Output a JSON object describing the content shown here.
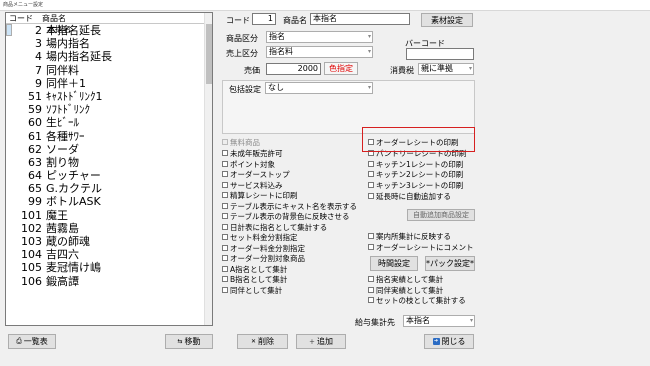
{
  "window": {
    "title": "商品メニュー設定"
  },
  "list": {
    "headers": {
      "code": "コード",
      "name": "商品名"
    },
    "items": [
      {
        "code": "1",
        "name": "本指名"
      },
      {
        "code": "2",
        "name": "本指名延長"
      },
      {
        "code": "3",
        "name": "場内指名"
      },
      {
        "code": "4",
        "name": "場内指名延長"
      },
      {
        "code": "7",
        "name": "同伴料"
      },
      {
        "code": "9",
        "name": "同伴＋1"
      },
      {
        "code": "51",
        "name": "ｷｬｽﾄﾄﾞﾘﾝｸ1"
      },
      {
        "code": "59",
        "name": "ｿﾌﾄﾄﾞﾘﾝｸ"
      },
      {
        "code": "60",
        "name": "生ﾋﾞｰﾙ"
      },
      {
        "code": "61",
        "name": "各種ｻﾜｰ"
      },
      {
        "code": "62",
        "name": "ソーダ"
      },
      {
        "code": "63",
        "name": "割り物"
      },
      {
        "code": "64",
        "name": "ピッチャー"
      },
      {
        "code": "65",
        "name": "G.カクテル"
      },
      {
        "code": "99",
        "name": "ボトルASK"
      },
      {
        "code": "101",
        "name": "魔王"
      },
      {
        "code": "102",
        "name": "茜霧島"
      },
      {
        "code": "103",
        "name": "蔵の師魂"
      },
      {
        "code": "104",
        "name": "吉四六"
      },
      {
        "code": "105",
        "name": "麦冠情け嶋"
      },
      {
        "code": "106",
        "name": "鍛高譚"
      }
    ],
    "selected_index": 0
  },
  "form": {
    "code_label": "コード",
    "code_value": "1",
    "name_label": "商品名",
    "name_value": "本指名",
    "material_button": "素材設定",
    "category_label": "商品区分",
    "category_value": "指名",
    "sales_category_label": "売上区分",
    "sales_category_value": "指名料",
    "barcode_label": "バーコード",
    "barcode_value": "",
    "price_label": "売価",
    "price_value": "2000",
    "color_button": "色指定",
    "tax_label": "消費税",
    "tax_value": "親に準拠",
    "package_label": "包括設定",
    "package_value": "なし"
  },
  "options": {
    "free_item": "無料商品",
    "left": [
      {
        "label": "未成年販売許可",
        "checked": false
      },
      {
        "label": "ポイント対象",
        "checked": false
      },
      {
        "label": "オーダーストップ",
        "checked": false
      },
      {
        "label": "サービス料込み",
        "checked": false
      },
      {
        "label": "精算レシートに印刷",
        "checked": false
      },
      {
        "label": "テーブル表示にキャスト名を表示する",
        "checked": false
      },
      {
        "label": "テーブル表示の背景色に反映させる",
        "checked": false
      },
      {
        "label": "日計表に指名として集計する",
        "checked": false
      },
      {
        "label": "セット料金分割指定",
        "checked": false
      },
      {
        "label": "オーダー料金分割指定",
        "checked": false
      },
      {
        "label": "オーダー分割対象商品",
        "checked": false
      },
      {
        "label": "A指名として集計",
        "checked": false
      },
      {
        "label": "B指名として集計",
        "checked": false
      },
      {
        "label": "同伴として集計",
        "checked": false
      }
    ],
    "right": [
      {
        "label": "オーダーレシートの印刷",
        "checked": false
      },
      {
        "label": "パントリーレシートの印刷",
        "checked": false
      },
      {
        "label": "キッチン1レシートの印刷",
        "checked": false
      },
      {
        "label": "キッチン2レシートの印刷",
        "checked": false
      },
      {
        "label": "キッチン3レシートの印刷",
        "checked": false
      },
      {
        "label": "延長時に自動追加する",
        "checked": false
      }
    ],
    "auto_add_button": "自動追加商品設定",
    "guide_reflect": "案内所集計に反映する",
    "order_receipt_comment": "オーダーレシートにコメント",
    "time_setting_button": "時間設定",
    "pack_setting_button": "*パック設定*",
    "right_bottom": [
      {
        "label": "指名実績として集計",
        "checked": false
      },
      {
        "label": "同伴実績として集計",
        "checked": false
      },
      {
        "label": "セットの枝として集計する",
        "checked": false
      }
    ],
    "salary_label": "給与集計先",
    "salary_value": "本指名"
  },
  "footer": {
    "list_button": "一覧表",
    "move_button": "移動",
    "delete_button": "削除",
    "add_button": "追加",
    "close_button": "閉じる"
  },
  "colors": {
    "selected_row": "#cce4f7",
    "highlight_border": "#d62020",
    "close_icon": "#2b6cc4"
  }
}
